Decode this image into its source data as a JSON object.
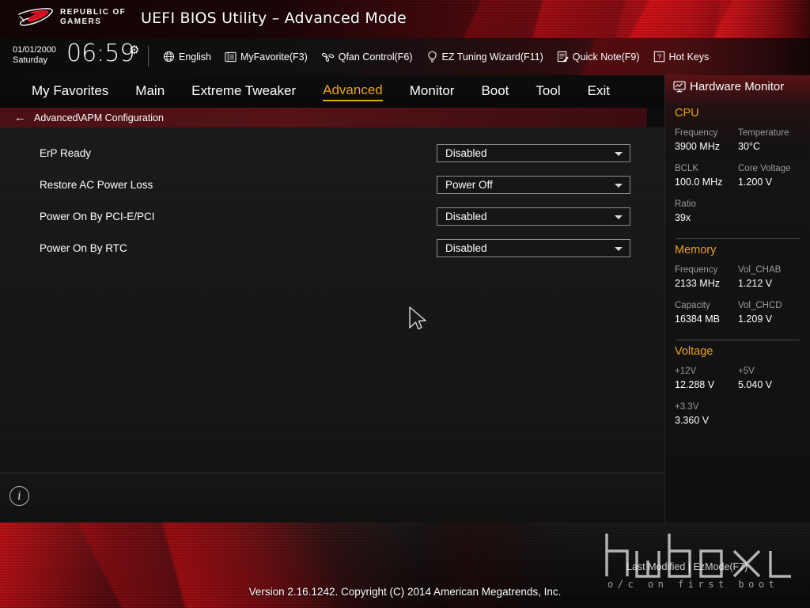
{
  "banner": {
    "logo_line1": "Republic of",
    "logo_line2": "Gamers",
    "title": "UEFI BIOS Utility – Advanced Mode"
  },
  "toolbar": {
    "date": "01/01/2000",
    "weekday": "Saturday",
    "time": "06:59",
    "gear_icon": "gear-icon",
    "items": [
      {
        "label": "English",
        "icon": "globe-icon"
      },
      {
        "label": "MyFavorite(F3)",
        "icon": "favorites-icon"
      },
      {
        "label": "Qfan Control(F6)",
        "icon": "fan-icon"
      },
      {
        "label": "EZ Tuning Wizard(F11)",
        "icon": "lightbulb-icon"
      },
      {
        "label": "Quick Note(F9)",
        "icon": "note-icon"
      },
      {
        "label": "Hot Keys",
        "icon": "question-key-icon"
      }
    ]
  },
  "nav": {
    "tabs": [
      {
        "label": "My Favorites",
        "active": false
      },
      {
        "label": "Main",
        "active": false
      },
      {
        "label": "Extreme Tweaker",
        "active": false
      },
      {
        "label": "Advanced",
        "active": true
      },
      {
        "label": "Monitor",
        "active": false
      },
      {
        "label": "Boot",
        "active": false
      },
      {
        "label": "Tool",
        "active": false
      },
      {
        "label": "Exit",
        "active": false
      }
    ],
    "active_color": "#e8a317"
  },
  "breadcrumb": {
    "back_icon": "back-arrow-icon",
    "path": "Advanced\\APM Configuration"
  },
  "settings": [
    {
      "label": "ErP Ready",
      "value": "Disabled"
    },
    {
      "label": "Restore AC Power Loss",
      "value": "Power Off"
    },
    {
      "label": "Power On By PCI-E/PCI",
      "value": "Disabled"
    },
    {
      "label": "Power On By RTC",
      "value": "Disabled"
    }
  ],
  "info_bar": {
    "icon": "info-icon",
    "help_text": ""
  },
  "hardware_monitor": {
    "title": "Hardware Monitor",
    "icon": "monitor-icon",
    "sections": [
      {
        "name": "CPU",
        "rows": [
          [
            {
              "key": "Frequency",
              "value": "3900 MHz"
            },
            {
              "key": "Temperature",
              "value": "30°C"
            }
          ],
          [
            {
              "key": "BCLK",
              "value": "100.0 MHz"
            },
            {
              "key": "Core Voltage",
              "value": "1.200 V"
            }
          ],
          [
            {
              "key": "Ratio",
              "value": "39x"
            }
          ]
        ]
      },
      {
        "name": "Memory",
        "rows": [
          [
            {
              "key": "Frequency",
              "value": "2133 MHz"
            },
            {
              "key": "Vol_CHAB",
              "value": "1.212 V"
            }
          ],
          [
            {
              "key": "Capacity",
              "value": "16384 MB"
            },
            {
              "key": "Vol_CHCD",
              "value": "1.209 V"
            }
          ]
        ]
      },
      {
        "name": "Voltage",
        "rows": [
          [
            {
              "key": "+12V",
              "value": "12.288 V"
            },
            {
              "key": "+5V",
              "value": "5.040 V"
            }
          ],
          [
            {
              "key": "+3.3V",
              "value": "3.360 V"
            }
          ]
        ]
      }
    ],
    "heading_color": "#e8a317"
  },
  "footer": {
    "version": "Version 2.16.1242. Copyright (C) 2014 American Megatrends, Inc.",
    "last_modified_label": "Last Modified  |  EzMode(F7)"
  },
  "watermark": {
    "text": "hwbox",
    "subtext": "o/c on first boot"
  },
  "colors": {
    "accent_yellow": "#e8a317",
    "rog_red": "#c6121a",
    "breadcrumb_red": "#551217",
    "panel_bg": "#121212",
    "content_bg": "#161616"
  }
}
